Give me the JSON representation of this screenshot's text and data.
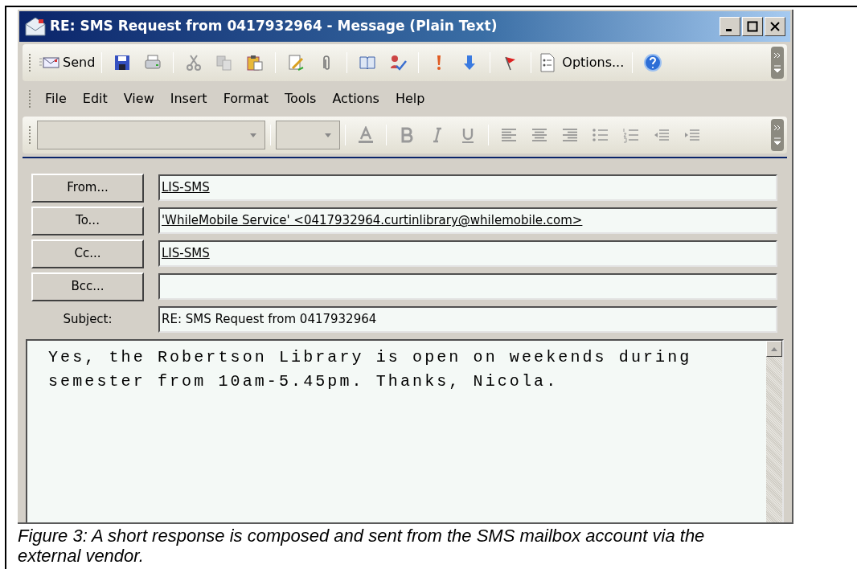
{
  "window": {
    "title": "RE: SMS Request from 0417932964 - Message (Plain Text)"
  },
  "toolbar": {
    "send": "Send",
    "options": "Options..."
  },
  "menu": [
    {
      "label": "File"
    },
    {
      "label": "Edit"
    },
    {
      "label": "View"
    },
    {
      "label": "Insert"
    },
    {
      "label": "Format"
    },
    {
      "label": "Tools"
    },
    {
      "label": "Actions"
    },
    {
      "label": "Help"
    }
  ],
  "fields": [
    {
      "kind": "button",
      "label": "From...",
      "value": "LIS-SMS",
      "resolved": true
    },
    {
      "kind": "button",
      "label": "To...",
      "value": "'WhileMobile Service' <0417932964.curtinlibrary@whilemobile.com>",
      "resolved": true
    },
    {
      "kind": "button",
      "label": "Cc...",
      "value": "LIS-SMS",
      "resolved": true
    },
    {
      "kind": "button",
      "label": "Bcc..."
    },
    {
      "kind": "label",
      "label": "Subject:",
      "value": "RE: SMS Request from 0417932964",
      "resolved": false
    }
  ],
  "body": {
    "lines": [
      "Yes, the Robertson Library is open on weekends during",
      "semester from 10am-5.45pm. Thanks, Nicola."
    ]
  },
  "caption": "Figure 3: A short response is composed and sent from the SMS mailbox account via the external vendor."
}
